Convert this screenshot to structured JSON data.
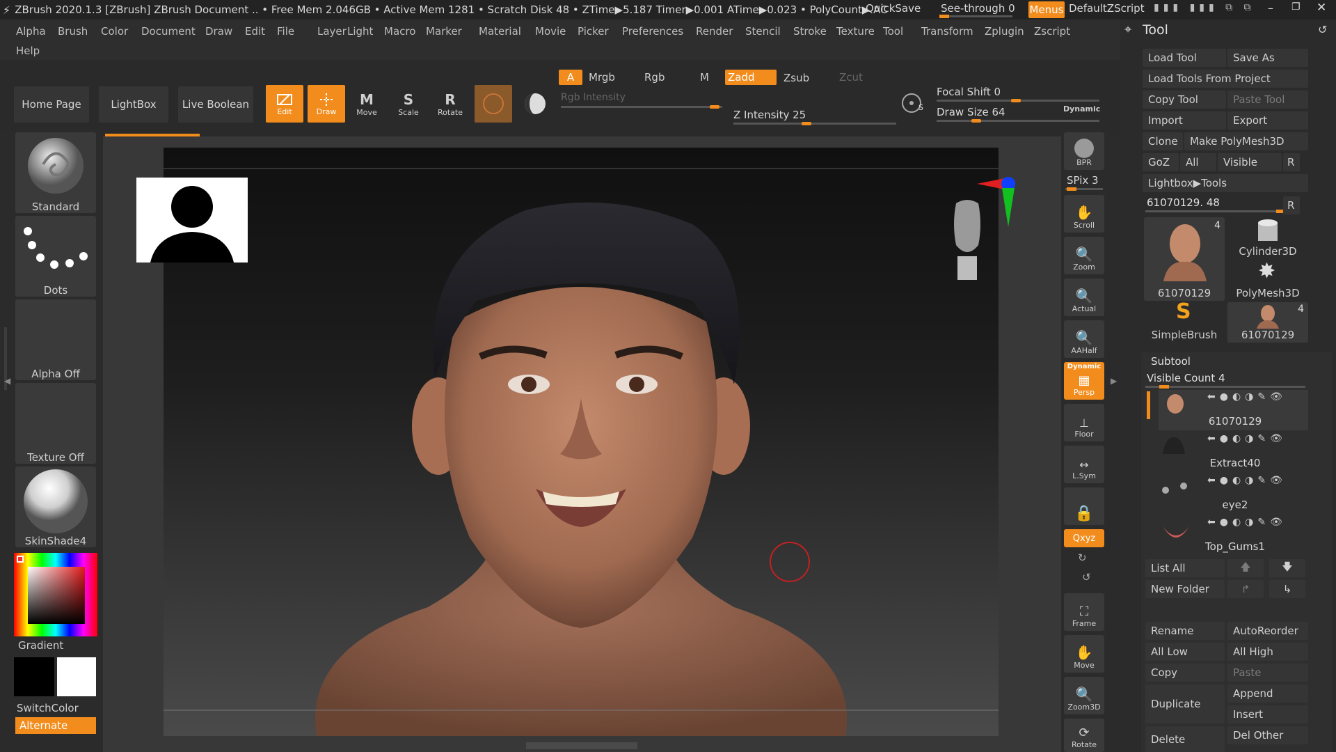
{
  "title_bar": {
    "text": "ZBrush 2020.1.3 [ZBrush]   ZBrush Document    .. • Free Mem 2.046GB • Active Mem 1281 • Scratch Disk 48 •  ZTime▶5.187 Timer▶0.001 ATime▶0.023 • PolyCount▶ AC",
    "quicksave": "QuickSave",
    "see_through": "See-through  0",
    "menus_btn": "Menus",
    "script_name": "DefaultZScript"
  },
  "menu_bar": {
    "items": [
      "Alpha",
      "Brush",
      "Color",
      "Document",
      "Draw",
      "Edit",
      "File",
      "Layer",
      "Light",
      "Macro",
      "Marker",
      "Material",
      "Movie",
      "Picker",
      "Preferences",
      "Render",
      "Stencil",
      "Stroke",
      "Texture",
      "Tool",
      "Transform",
      "Zplugin",
      "Zscript"
    ],
    "help": "Help"
  },
  "toolbar": {
    "home_page": "Home Page",
    "lightbox": "LightBox",
    "live_boolean": "Live Boolean",
    "edit": "Edit",
    "draw": "Draw",
    "move": "Move",
    "scale": "Scale",
    "rotate": "Rotate",
    "a": "A",
    "mrgb": "Mrgb",
    "rgb": "Rgb",
    "m": "M",
    "zadd": "Zadd",
    "zsub": "Zsub",
    "zcut": "Zcut",
    "rgb_intensity": "Rgb Intensity",
    "z_intensity": "Z Intensity 25",
    "focal_shift": "Focal Shift 0",
    "draw_size": "Draw Size 64",
    "dynamic": "Dynamic",
    "z_intensity_value": 25,
    "focal_shift_value": 0,
    "draw_size_value": 64
  },
  "left_panel": {
    "brush": "Standard",
    "stroke": "Dots",
    "alpha": "Alpha Off",
    "texture": "Texture Off",
    "material": "SkinShade4",
    "gradient": "Gradient",
    "switch_color": "SwitchColor",
    "alternate": "Alternate"
  },
  "shelf": {
    "bpr": "BPR",
    "spix": "SPix 3",
    "scroll": "Scroll",
    "zoom": "Zoom",
    "actual": "Actual",
    "aahalf": "AAHalf",
    "dynamic_badge": "Dynamic",
    "persp": "Persp",
    "floor": "Floor",
    "lsym": "L.Sym",
    "xyz": "Qxyz",
    "frame": "Frame",
    "move": "Move",
    "zoom3d": "Zoom3D",
    "rotate": "Rotate"
  },
  "tool_panel": {
    "title": "Tool",
    "load_tool": "Load Tool",
    "save_as": "Save As",
    "load_from_project": "Load Tools From Project",
    "copy_tool": "Copy Tool",
    "paste_tool": "Paste Tool",
    "import": "Import",
    "export": "Export",
    "clone": "Clone",
    "make_polymesh": "Make PolyMesh3D",
    "goz": "GoZ",
    "all": "All",
    "visible": "Visible",
    "r": "R",
    "lightbox_tools": "Lightbox▶Tools",
    "current_tool": "61070129. 48",
    "thumbs": [
      {
        "name": "61070129",
        "badge": "4"
      },
      {
        "name": "Cylinder3D",
        "badge": ""
      },
      {
        "name": "PolyMesh3D",
        "badge": ""
      },
      {
        "name": "SimpleBrush",
        "badge": ""
      },
      {
        "name": "61070129",
        "badge": "4"
      }
    ],
    "subtool_title": "Subtool",
    "visible_count": "Visible Count 4",
    "subtools": [
      "61070129",
      "Extract40",
      "eye2",
      "Top_Gums1"
    ],
    "list_all": "List All",
    "new_folder": "New Folder",
    "rename": "Rename",
    "autoreorder": "AutoReorder",
    "all_low": "All Low",
    "all_high": "All High",
    "copy": "Copy",
    "paste": "Paste",
    "duplicate": "Duplicate",
    "append": "Append",
    "insert": "Insert",
    "delete": "Delete",
    "del_other": "Del Other"
  },
  "colors": {
    "accent": "#f28c1c",
    "panel": "#2b2b2b",
    "button": "#353535"
  }
}
